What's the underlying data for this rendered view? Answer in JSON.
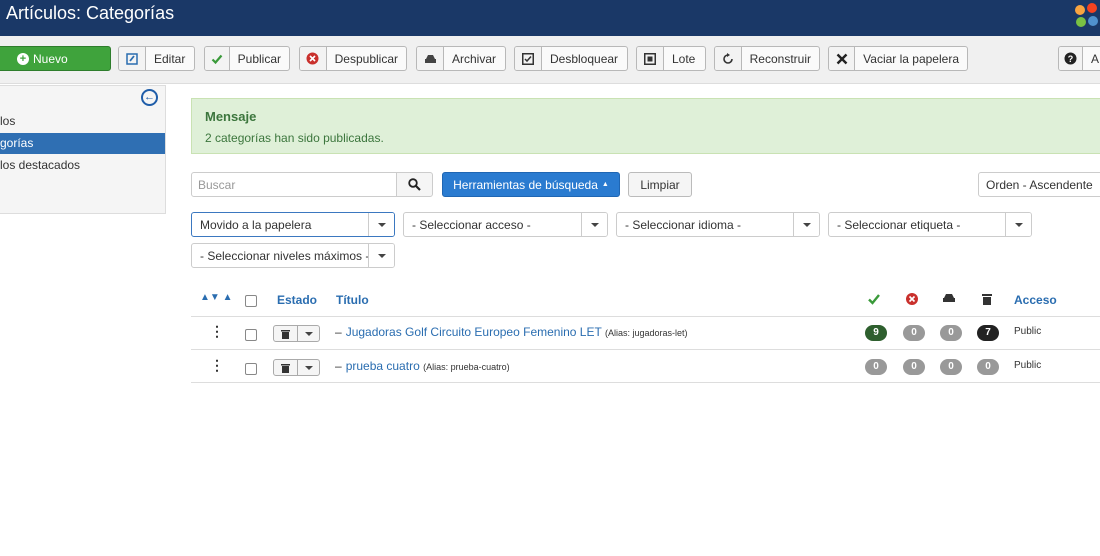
{
  "header": {
    "title": "Artículos: Categorías",
    "logo": "joomla-logo-icon"
  },
  "toolbar": {
    "new_label": "Nuevo",
    "edit_label": "Editar",
    "publish_label": "Publicar",
    "unpublish_label": "Despublicar",
    "archive_label": "Archivar",
    "checkin_label": "Desbloquear",
    "batch_label": "Lote",
    "rebuild_label": "Reconstruir",
    "trash_label": "Vaciar la papelera",
    "help_label": "A"
  },
  "sidebar": {
    "items": [
      {
        "label": "los",
        "active": false
      },
      {
        "label": "gorías",
        "active": true
      },
      {
        "label": "los destacados",
        "active": false
      }
    ]
  },
  "message": {
    "title": "Mensaje",
    "text": "2 categorías han sido publicadas."
  },
  "search": {
    "placeholder": "Buscar",
    "tools_label": "Herramientas de búsqueda",
    "clear_label": "Limpiar",
    "order_value": "Orden - Ascendente"
  },
  "filters": {
    "status": "Movido a la papelera",
    "access": "- Seleccionar acceso -",
    "language": "- Seleccionar idioma -",
    "tag": "- Seleccionar etiqueta -",
    "levels": "- Seleccionar niveles máximos -"
  },
  "table": {
    "headers": {
      "status": "Estado",
      "title": "Título",
      "access": "Acceso"
    },
    "rows": [
      {
        "title": "Jugadoras Golf Circuito Europeo Femenino LET",
        "alias": "(Alias: jugadoras-let)",
        "published": "9",
        "unpublished": "0",
        "archived": "0",
        "trashed": "7",
        "access": "Public"
      },
      {
        "title": "prueba cuatro",
        "alias": "(Alias: prueba-cuatro)",
        "published": "0",
        "unpublished": "0",
        "archived": "0",
        "trashed": "0",
        "access": "Public"
      }
    ]
  },
  "colors": {
    "header_bg": "#1a3867",
    "new_button": "#3fa33c",
    "primary": "#2a7bd0",
    "badge_published": "#2e5f2e",
    "badge_trashed": "#222222",
    "badge_zero": "#999999"
  }
}
